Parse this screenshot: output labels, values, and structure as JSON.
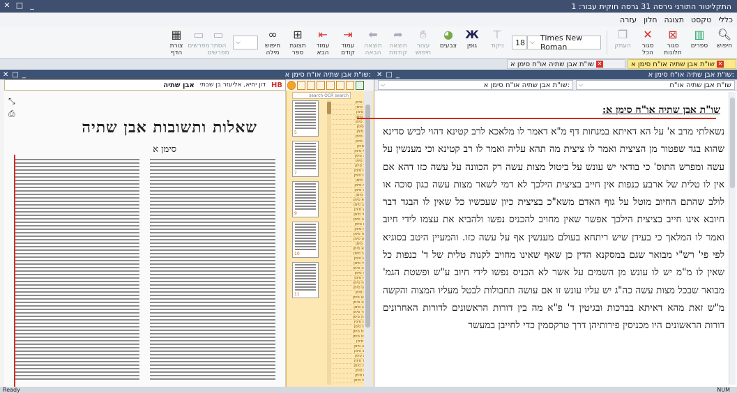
{
  "window": {
    "title": "התקליטור התורני גירסה 31 גרסה חוקית עבור: 1"
  },
  "menu": [
    "כללי",
    "טקסט",
    "תצוגה",
    "חלון",
    "עזרה"
  ],
  "ribbon": {
    "buttons": [
      {
        "label": "חיפוש",
        "icon": "search-icon"
      },
      {
        "label": "ספרים",
        "icon": "books-icon"
      },
      {
        "label": "סגור חלונות",
        "icon": "close-windows-icon"
      },
      {
        "label": "סגור הכל",
        "icon": "close-all-icon"
      },
      {
        "label": "העתק",
        "icon": "copy-icon"
      },
      {
        "label": "ניקוד",
        "icon": "nikud-icon"
      },
      {
        "label": "גופן",
        "icon": "font-icon"
      },
      {
        "label": "צבעים",
        "icon": "palette-icon"
      },
      {
        "label": "עצור חיפוש",
        "icon": "hand-icon"
      },
      {
        "label": "תוצאה קודמת",
        "icon": "redo-icon"
      },
      {
        "label": "תוצאה הבאה",
        "icon": "undo-icon"
      },
      {
        "label": "עמוד קודם",
        "icon": "page-prev-icon"
      },
      {
        "label": "עמוד הבא",
        "icon": "page-next-icon"
      },
      {
        "label": "תצוגת ספר",
        "icon": "book-view-icon"
      },
      {
        "label": "חיפוש מילה",
        "icon": "binoculars-icon"
      },
      {
        "label": "הסתר מפרשים",
        "icon": "hide-commentary-icon"
      },
      {
        "label": "מפרשים",
        "icon": "commentary-icon"
      },
      {
        "label": "צורת הדף",
        "icon": "page-layout-icon"
      }
    ],
    "font_name": "Times New Roman",
    "font_size": "18",
    "search_value": ""
  },
  "tabs": [
    {
      "label": "שו\"ת אבן שתיה או\"ח סימן א",
      "active": true
    },
    {
      "label": "שו\"ת אבן שתיה או\"ח סימן א",
      "active": false
    }
  ],
  "right_pane": {
    "header": "שו\"ת אבן שתיה או\"ח סימן א:",
    "combo_book": "שו\"ת אבן שתיה או\"ח",
    "combo_section": "שו\"ת אבן שתיה או\"ח סימן א:",
    "title": "שו\"ת אבן שתיה או\"ח סימן א:",
    "body": "נשאלתי מרב א' על הא דאיתא במנחות דף מ\"א דאמר לו מלאכא לרב קטינא דהוי לביש סדינא שהוא בגד שפטור מן הציצית ואמר לו ציצית מה תהא עליה ואמר לו רב קטינא וכי מענשין על עשה ומפרש התוס' כי בודאי יש עונש על ביטול מצות עשה רק הכוונה על עשה כזו דהא אם אין לו טלית של ארבע כנפות אין חייב בציצית הילכך לא דמי לשאר מצות עשה כגון סוכה או לולב שהתם החיוב מוטל על גוף האדם משא\"כ בציצית כיון שעכשיו כל שאין לו הבגד דבר חיובא אינו חייב בציצית הילכך אפשר שאין מחויב להכניס נפשו ולהביא את עצמו לידי חיוב ואמר לו המלאך כי בעידן שיש ריתחא בעולם מענשין אף על עשה כזו. והמעיין היטב בסוגיא לפי פי' רש\"י מבואר שגם במסקנא הדין כן שאף שאינו מחויב לקנות טלית של ד' כנפות כל שאין לו מ\"מ יש לו עונש מן השמים על אשר לא הכניס נפשו לידי חיוב ע\"ש ופשטת הגמ' מבואר שבכל מצות עשה כה\"ג יש עליו עונש זו אם עושה תחבולות לבטל מעליו המצוה והקשה מ\"ש זאת מהא דאיתא בברכות ובגיטין ד' פ\"א מה בין דורות הראשונים לדורות האחרונים דורות הראשונים היו מכניסין פירותיהן דרך טרקסמין כדי לחייבן במעשר"
  },
  "left_pane": {
    "header": "שו\"ת אבן שתיה או\"ח סימן א:",
    "hb_logo": "HB",
    "author": "דון יחיא, אליעזר בן שבתי",
    "book_name": "אבן שתיה",
    "page_title": "שאלות ותשובות אבן שתיה",
    "page_subtitle": "סימן א",
    "thumb_search_placeholder": "search OCR search",
    "thumb_page_numbers": [
      "5",
      "7",
      "9",
      "10",
      "11"
    ],
    "thumb_list": [
      "א סימן",
      "ב סימן",
      "ג סימן",
      "ד סימן",
      "ה סימן",
      "ו סימן",
      "ז סימן",
      "ח סימן",
      "ט סימן",
      "י סימן",
      "יא סימן",
      "יב סימן",
      "יג סימן",
      "יד סימן",
      "טו סימן",
      "טז סימן",
      "יז סימן",
      "יח סימן",
      "יט סימן",
      "כ סימן",
      "כא סימן",
      "כב סימן",
      "כג סימן",
      "כד סימן",
      "כה סימן",
      "כו סימן",
      "כז סימן",
      "כח סימן",
      "כט סימן",
      "ל סימן",
      "לא סימן",
      "לב סימן",
      "לג סימן",
      "לד סימן",
      "לה סימן",
      "לו סימן",
      "לז סימן",
      "לח סימן",
      "לט סימן",
      "מ סימן",
      "מא סימן",
      "מב סימן",
      "מג סימן",
      "מד סימן",
      "מה סימן",
      "מו סימן",
      "מז סימן",
      "מח סימן",
      "מט סימן",
      "נ סימן",
      "נא סימן",
      "נב סימן",
      "נג סימן",
      "נד סימן",
      "נה סימן",
      "נו סימן",
      "נז סימן",
      "נח סימן"
    ]
  },
  "status": {
    "left": "Ready",
    "right": "NUM"
  },
  "colors": {
    "title_bar": "#3f4f6f",
    "pane_header": "#3d5376",
    "active_tab": "#fde98a",
    "thumbs_bg": "#fde7b2",
    "marker_red": "#d42a20"
  }
}
